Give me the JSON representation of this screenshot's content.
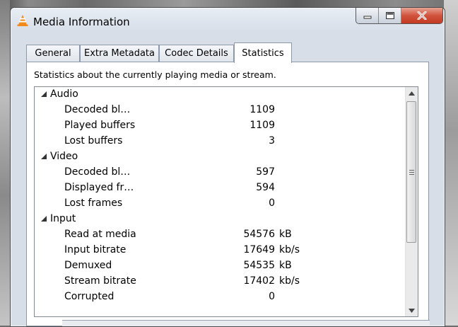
{
  "window": {
    "title": "Media Information",
    "title_icon": "vlc-cone-icon",
    "controls": [
      "minimize-icon",
      "maximize-icon",
      "close-icon"
    ]
  },
  "tabs": [
    {
      "label": "General",
      "active": false
    },
    {
      "label": "Extra Metadata",
      "active": false
    },
    {
      "label": "Codec Details",
      "active": false
    },
    {
      "label": "Statistics",
      "active": true
    }
  ],
  "statistics": {
    "description": "Statistics about the currently playing media or stream.",
    "categories": [
      {
        "label": "Audio",
        "items": [
          {
            "label": "Decoded bl…",
            "value": "1109",
            "unit": ""
          },
          {
            "label": "Played buffers",
            "value": "1109",
            "unit": ""
          },
          {
            "label": "Lost buffers",
            "value": "3",
            "unit": ""
          }
        ]
      },
      {
        "label": "Video",
        "items": [
          {
            "label": "Decoded bl…",
            "value": "597",
            "unit": ""
          },
          {
            "label": "Displayed fr…",
            "value": "594",
            "unit": ""
          },
          {
            "label": "Lost frames",
            "value": "0",
            "unit": ""
          }
        ]
      },
      {
        "label": "Input",
        "items": [
          {
            "label": "Read at media",
            "value": "54576",
            "unit": "kB"
          },
          {
            "label": "Input bitrate",
            "value": "17649",
            "unit": "kb/s"
          },
          {
            "label": "Demuxed",
            "value": "54535",
            "unit": "kB"
          },
          {
            "label": "Stream bitrate",
            "value": "17402",
            "unit": "kb/s"
          },
          {
            "label": "Corrupted",
            "value": "0",
            "unit": ""
          }
        ]
      }
    ]
  },
  "colors": {
    "accent_close": "#c43a21",
    "vlc_orange": "#f08a1c"
  }
}
